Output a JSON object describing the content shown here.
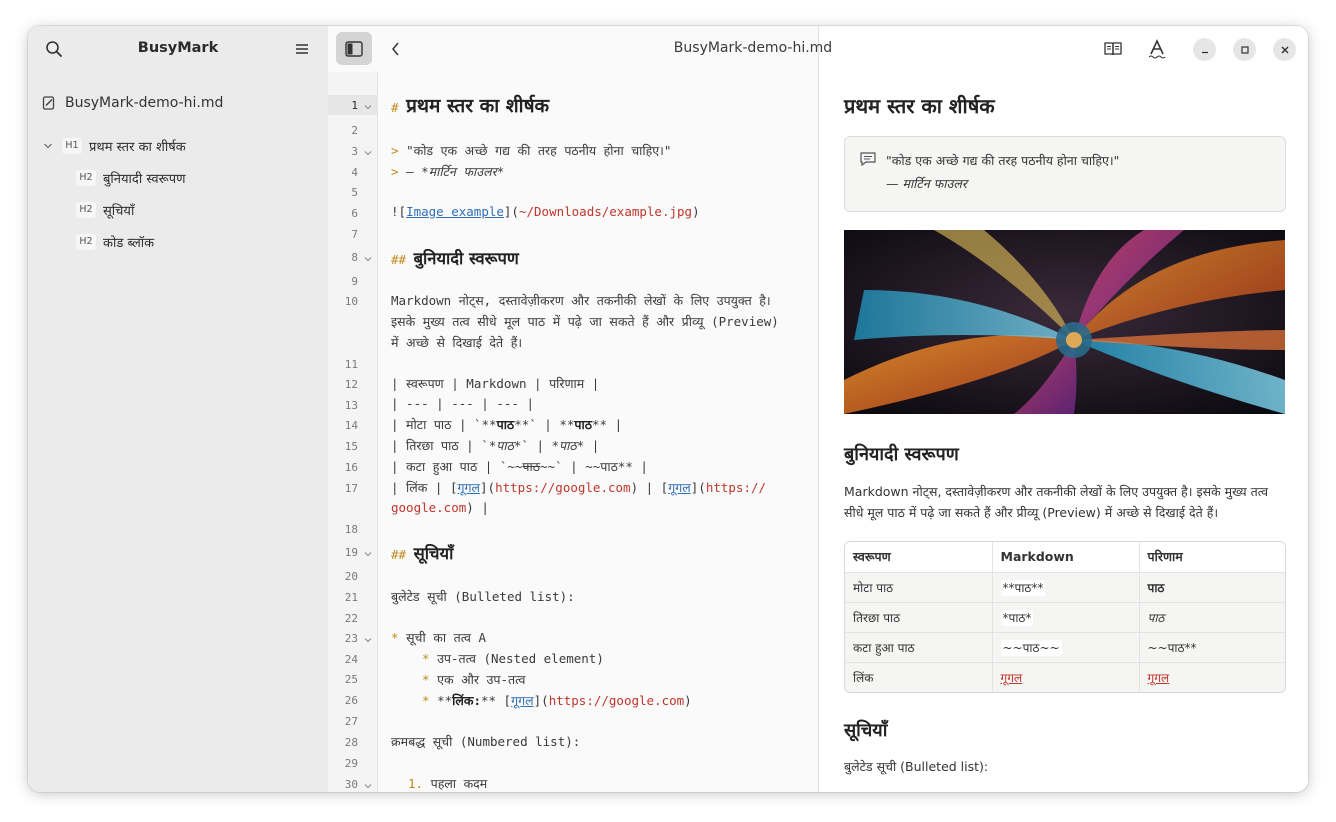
{
  "sidebar": {
    "title": "BusyMark",
    "file": "BusyMark-demo-hi.md",
    "outline": [
      {
        "level": "H1",
        "label": "प्रथम स्तर का शीर्षक"
      },
      {
        "level": "H2",
        "label": "बुनियादी स्वरूपण"
      },
      {
        "level": "H2",
        "label": "सूचियाँ"
      },
      {
        "level": "H2",
        "label": "कोड ब्लॉक"
      }
    ]
  },
  "header": {
    "doc_title": "BusyMark-demo-hi.md"
  },
  "editor": {
    "line_numbers": [
      "1",
      "2",
      "3",
      "4",
      "5",
      "6",
      "7",
      "8",
      "9",
      "10",
      "11",
      "12",
      "13",
      "14",
      "15",
      "16",
      "17",
      "18",
      "19",
      "20",
      "21",
      "22",
      "23",
      "24",
      "25",
      "26",
      "27",
      "28",
      "29",
      "30"
    ],
    "lines": {
      "l1_mark": "#",
      "l1_text": "प्रथम स्तर का शीर्षक",
      "l3_mark": ">",
      "l3_text": "\"कोड एक अच्छे गद्य की तरह पठनीय होना चाहिए।\"",
      "l4_mark": ">",
      "l4_dash": "— ",
      "l4_star_open": "*",
      "l4_text": "मार्टिन फाउलर",
      "l4_star_close": "*",
      "l6_open": "![",
      "l6_link": "Image example",
      "l6_mid": "](",
      "l6_url": "~/Downloads/example.jpg",
      "l6_close": ")",
      "l8_mark": "##",
      "l8_text": "बुनियादी स्वरूपण",
      "l10_a": "Markdown नोट्स, दस्तावेज़ीकरण और तकनीकी लेखों के लिए उपयुक्त है।",
      "l10_b": "इसके मुख्य तत्व सीधे मूल पाठ में पढ़े जा सकते हैं और प्रीव्यू (Preview)",
      "l10_c": "में अच्छे से दिखाई देते हैं।",
      "l12": "| स्वरूपण | Markdown | परिणाम |",
      "l13": "| --- | --- | --- |",
      "l14_a": "| मोटा पाठ | `**",
      "l14_b": "पाठ",
      "l14_c": "**` | **",
      "l14_d": "पाठ",
      "l14_e": "** |",
      "l15_a": "| तिरछा पाठ | `*",
      "l15_b": "पाठ",
      "l15_c": "*` | *",
      "l15_d": "पाठ",
      "l15_e": "* |",
      "l16_a": "| कटा हुआ पाठ | `~~",
      "l16_b": "पाठ",
      "l16_c": "~~` | ~~पाठ** |",
      "l17_a": "| लिंक | [",
      "l17_link1": "गूगल",
      "l17_b": "](",
      "l17_url1": "https://google.com",
      "l17_c": ") | [",
      "l17_link2": "गूगल",
      "l17_d": "](",
      "l17_url2a": "https://",
      "l17_url2b": "google.com",
      "l17_e": ") |",
      "l19_mark": "##",
      "l19_text": "सूचियाँ",
      "l21": "बुलेटेड सूची (Bulleted list):",
      "l23_mark": "*",
      "l23_text": "सूची का तत्व A",
      "l24_mark": "*",
      "l24_text": "उप-तत्व (Nested element)",
      "l25_mark": "*",
      "l25_text": "एक और उप-तत्व",
      "l26_mark": "*",
      "l26_a": "**",
      "l26_b": "लिंक:",
      "l26_c": "** [",
      "l26_link": "गूगल",
      "l26_d": "](",
      "l26_url": "https://google.com",
      "l26_e": ")",
      "l28": "क्रमबद्ध सूची (Numbered list):",
      "l30_mark": "1.",
      "l30_text": "पहला कदम"
    }
  },
  "preview": {
    "h1": "प्रथम स्तर का शीर्षक",
    "quote_text": "\"कोड एक अच्छे गद्य की तरह पठनीय होना चाहिए।\"",
    "quote_author": "— मार्टिन फाउलर",
    "h2_formatting": "बुनियादी स्वरूपण",
    "para_formatting": "Markdown नोट्स, दस्तावेज़ीकरण और तकनीकी लेखों के लिए उपयुक्त है। इसके मुख्य तत्व सीधे मूल पाठ में पढ़े जा सकते हैं और प्रीव्यू (Preview) में अच्छे से दिखाई देते हैं।",
    "table": {
      "headers": [
        "स्वरूपण",
        "Markdown",
        "परिणाम"
      ],
      "rows": [
        {
          "c1": "मोटा पाठ",
          "c2": "**पाठ**",
          "c3": "पाठ"
        },
        {
          "c1": "तिरछा पाठ",
          "c2": "*पाठ*",
          "c3": "पाठ"
        },
        {
          "c1": "कटा हुआ पाठ",
          "c2": "~~पाठ~~",
          "c3": "~~पाठ**"
        },
        {
          "c1": "लिंक",
          "c2": "गूगल",
          "c3": "गूगल"
        }
      ]
    },
    "h2_lists": "सूचियाँ",
    "para_lists": "बुलेटेड सूची (Bulleted list):"
  },
  "colors": {
    "markdown_marker": "#c08a1e",
    "link": "#2f6fb5",
    "url": "#c0362c",
    "sidebar_bg": "#ebebeb"
  }
}
